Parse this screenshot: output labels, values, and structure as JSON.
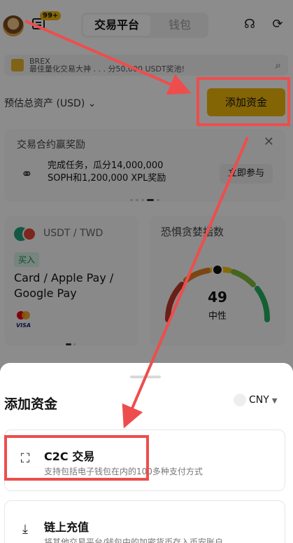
{
  "header": {
    "badge": "99+",
    "tabs": [
      {
        "label": "交易平台",
        "active": true
      },
      {
        "label": "钱包",
        "active": false
      }
    ],
    "icons": [
      "avatar",
      "message-icon",
      "headset-icon",
      "settings-icon"
    ]
  },
  "search": {
    "text": "BREX",
    "subtext": "最佳量化交易大神 . . . 分50,000 USDT奖池!"
  },
  "assets": {
    "label": "预估总资产 (USD)",
    "add_funds": "添加资金"
  },
  "promo": {
    "title": "交易合约赢奖励",
    "line1": "完成任务，瓜分14,000,000",
    "line2": "SOPH和1,200,000 XPL奖励",
    "join": "立即参与"
  },
  "p2p_card": {
    "pair": "USDT / TWD",
    "tag": "买入",
    "payment": "Card / Apple Pay / Google Pay",
    "visa": "VISA"
  },
  "fear_greed": {
    "title": "恐惧贪婪指数",
    "value": "49",
    "label": "中性",
    "level": 49
  },
  "sheet": {
    "title": "添加资金",
    "currency": "CNY",
    "options": [
      {
        "title": "C2C 交易",
        "desc": "支持包括电子钱包在内的100多种支付方式",
        "icon": "person-scan-icon"
      },
      {
        "title": "链上充值",
        "desc": "将其他交易平台/钱包中的加密货币存入币安账户",
        "icon": "download-icon"
      }
    ]
  },
  "colors": {
    "accent": "#f0b90b",
    "annotation": "#ee4d4d"
  }
}
